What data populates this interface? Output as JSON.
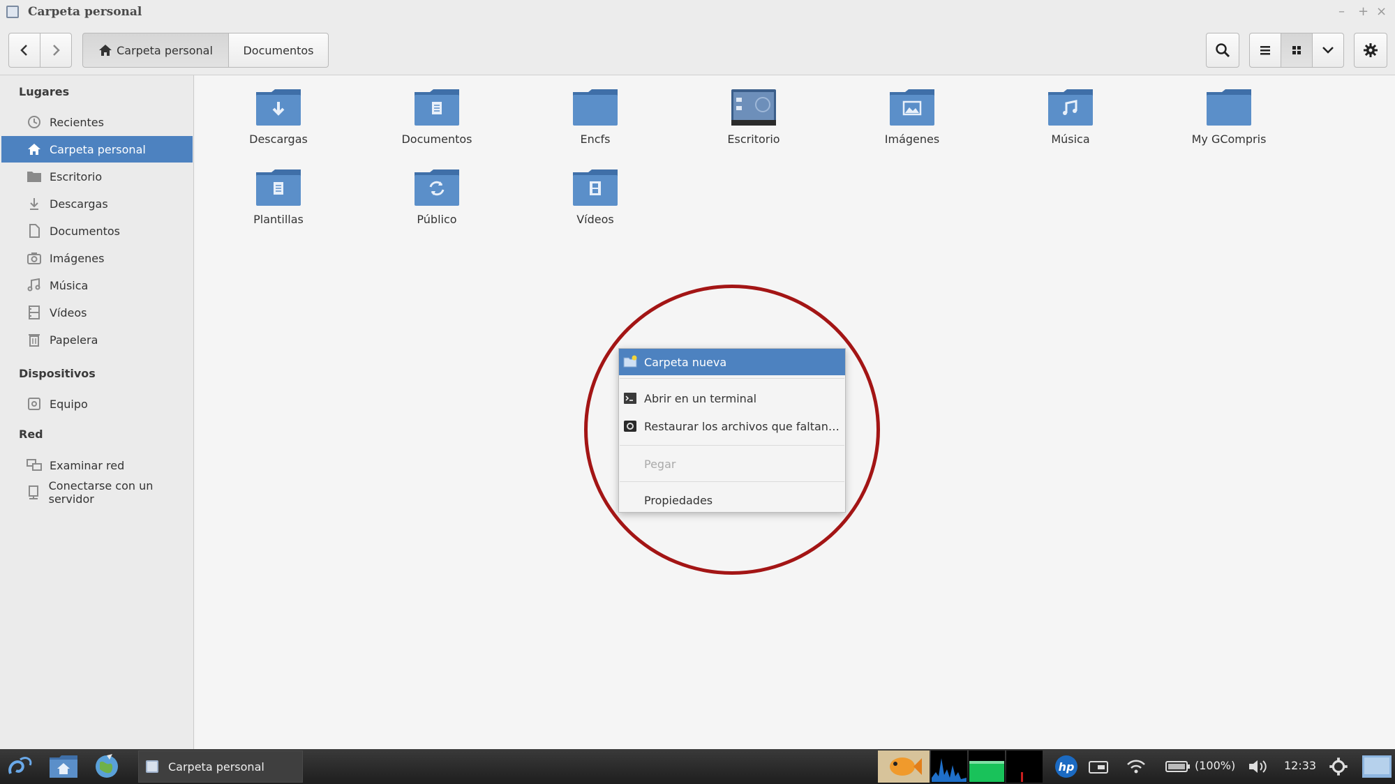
{
  "window": {
    "title": "Carpeta personal",
    "controls": {
      "minimize": "–",
      "maximize": "+",
      "close": "×"
    }
  },
  "toolbar": {
    "back_icon": "chevron-left-icon",
    "forward_icon": "chevron-right-icon",
    "path": [
      {
        "label": "Carpeta personal",
        "icon": "home-icon",
        "active": true
      },
      {
        "label": "Documentos",
        "active": false
      }
    ],
    "search_icon": "search-icon",
    "list_view_icon": "list-icon",
    "grid_view_icon": "grid-icon",
    "view_options_icon": "chevron-down-icon",
    "settings_icon": "gear-icon"
  },
  "sidebar": {
    "sections": [
      {
        "heading": "Lugares",
        "items": [
          {
            "label": "Recientes",
            "icon": "clock-icon"
          },
          {
            "label": "Carpeta personal",
            "icon": "home-icon",
            "active": true
          },
          {
            "label": "Escritorio",
            "icon": "desktop-folder-icon"
          },
          {
            "label": "Descargas",
            "icon": "download-icon"
          },
          {
            "label": "Documentos",
            "icon": "document-icon"
          },
          {
            "label": "Imágenes",
            "icon": "camera-icon"
          },
          {
            "label": "Música",
            "icon": "music-icon"
          },
          {
            "label": "Vídeos",
            "icon": "film-icon"
          },
          {
            "label": "Papelera",
            "icon": "trash-icon"
          }
        ]
      },
      {
        "heading": "Dispositivos",
        "items": [
          {
            "label": "Equipo",
            "icon": "drive-icon"
          }
        ]
      },
      {
        "heading": "Red",
        "items": [
          {
            "label": "Examinar red",
            "icon": "network-icon"
          },
          {
            "label": "Conectarse con un servidor",
            "icon": "server-icon"
          }
        ]
      }
    ]
  },
  "files": [
    {
      "label": "Descargas",
      "icon": "folder-download-icon"
    },
    {
      "label": "Documentos",
      "icon": "folder-documents-icon"
    },
    {
      "label": "Encfs",
      "icon": "folder-icon"
    },
    {
      "label": "Escritorio",
      "icon": "folder-desktop-icon"
    },
    {
      "label": "Imágenes",
      "icon": "folder-pictures-icon"
    },
    {
      "label": "Música",
      "icon": "folder-music-icon"
    },
    {
      "label": "My GCompris",
      "icon": "folder-icon"
    },
    {
      "label": "Plantillas",
      "icon": "folder-templates-icon"
    },
    {
      "label": "Público",
      "icon": "folder-public-icon"
    },
    {
      "label": "Vídeos",
      "icon": "folder-videos-icon"
    }
  ],
  "context_menu": {
    "items": [
      {
        "label": "Carpeta nueva",
        "icon": "new-folder-icon",
        "highlighted": true,
        "enabled": true
      },
      {
        "label": "Abrir en un terminal",
        "icon": "terminal-icon",
        "enabled": true
      },
      {
        "label": "Restaurar los archivos que faltan…",
        "icon": "restore-icon",
        "enabled": true
      },
      {
        "label": "Pegar",
        "enabled": false
      },
      {
        "label": "Propiedades",
        "enabled": true
      }
    ]
  },
  "taskbar": {
    "window_label": "Carpeta personal",
    "battery": "(100%)",
    "clock": "12:33"
  },
  "colors": {
    "accent": "#4d82c0",
    "folder": "#5b8fc9",
    "highlight_circle": "#a31515"
  }
}
